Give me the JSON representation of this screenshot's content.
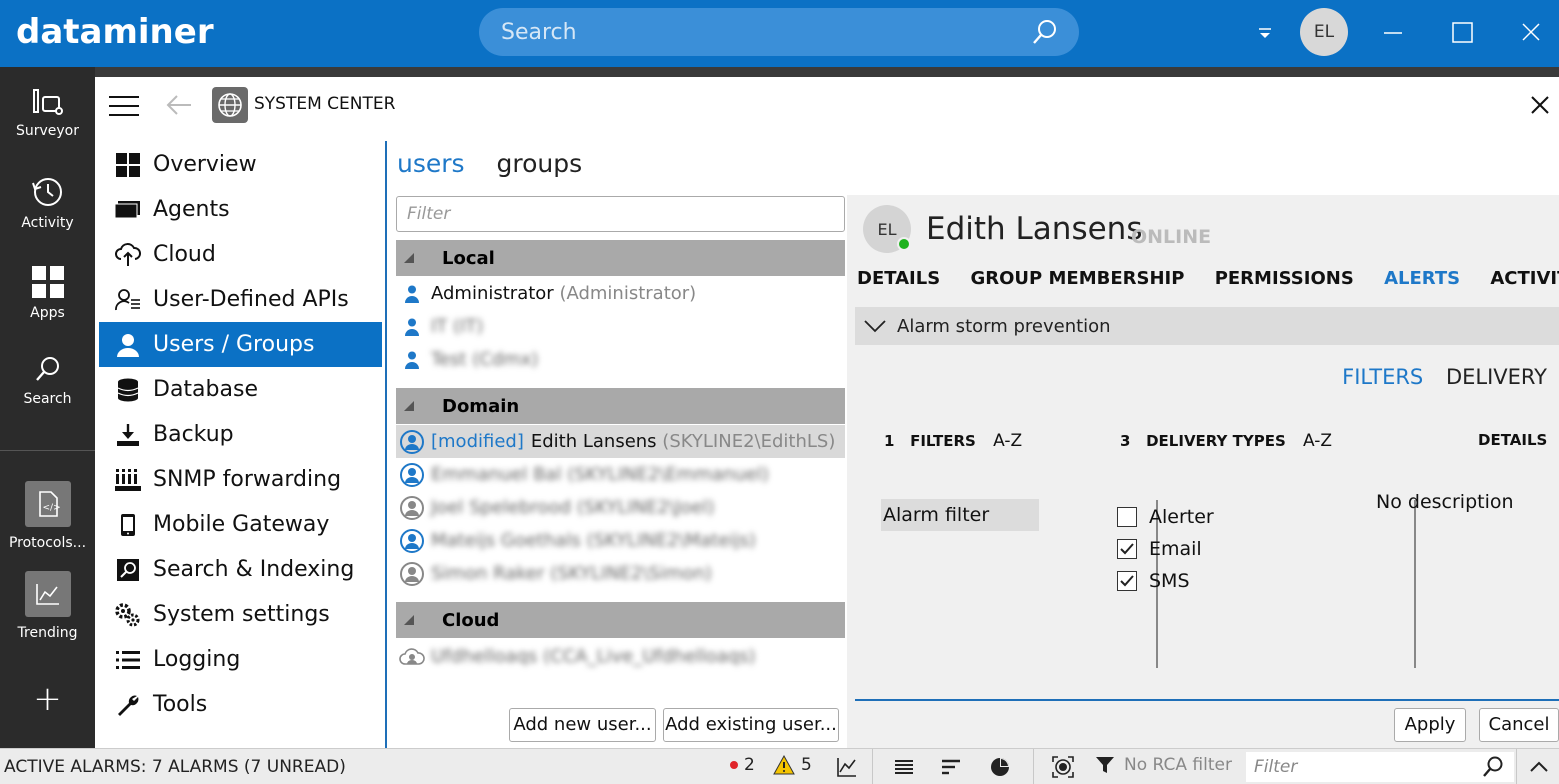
{
  "app": {
    "logo": "dataminer",
    "search_placeholder": "Search",
    "user_initials": "EL"
  },
  "sidebar": {
    "items": [
      {
        "label": "Surveyor",
        "icon": "surveyor-icon"
      },
      {
        "label": "Activity",
        "icon": "history-icon"
      },
      {
        "label": "Apps",
        "icon": "apps-grid-icon"
      },
      {
        "label": "Search",
        "icon": "search-icon"
      },
      {
        "label": "Protocols...",
        "icon": "protocol-file-icon"
      },
      {
        "label": "Trending",
        "icon": "trend-chart-icon"
      }
    ],
    "add_label": "+"
  },
  "system_center": {
    "title": "SYSTEM CENTER",
    "nav": [
      {
        "label": "Overview",
        "icon": "overview-grid-icon"
      },
      {
        "label": "Agents",
        "icon": "agents-icon"
      },
      {
        "label": "Cloud",
        "icon": "cloud-upload-icon"
      },
      {
        "label": "User-Defined APIs",
        "icon": "api-user-icon"
      },
      {
        "label": "Users / Groups",
        "icon": "user-icon"
      },
      {
        "label": "Database",
        "icon": "database-icon"
      },
      {
        "label": "Backup",
        "icon": "download-icon"
      },
      {
        "label": "SNMP forwarding",
        "icon": "snmp-icon"
      },
      {
        "label": "Mobile Gateway",
        "icon": "mobile-icon"
      },
      {
        "label": "Search & Indexing",
        "icon": "search-index-icon"
      },
      {
        "label": "System settings",
        "icon": "gears-icon"
      },
      {
        "label": "Logging",
        "icon": "list-icon"
      },
      {
        "label": "Tools",
        "icon": "wrench-icon"
      }
    ],
    "active_nav": "Users / Groups"
  },
  "users_groups": {
    "tabs": [
      {
        "label": "users",
        "active": true
      },
      {
        "label": "groups",
        "active": false
      }
    ],
    "filter_placeholder": "Filter",
    "groups": [
      {
        "name": "Local",
        "users": [
          {
            "name": "Administrator",
            "detail": "(Administrator)"
          },
          {
            "name": "IT",
            "detail": "(IT)",
            "blurred": true
          },
          {
            "name": "Test",
            "detail": "(Cdmx)",
            "blurred": true
          }
        ]
      },
      {
        "name": "Domain",
        "users": [
          {
            "modified": "[modified]",
            "name": "Edith Lansens",
            "detail": "(SKYLINE2\\EdithLS)",
            "selected": true
          },
          {
            "name": "Emmanuel Bal",
            "detail": "(SKYLINE2\\Emmanuel)",
            "blurred": true
          },
          {
            "name": "Joel Spelebrood",
            "detail": "(SKYLINE2\\Joel)",
            "blurred": true
          },
          {
            "name": "Mateijs Goethals",
            "detail": "(SKYLINE2\\Mateijs)",
            "blurred": true
          },
          {
            "name": "Simon Raker",
            "detail": "(SKYLINE2\\Simon)",
            "blurred": true
          }
        ]
      },
      {
        "name": "Cloud",
        "users": [
          {
            "name": "Ufdhelloaqs",
            "detail": "(CCA_Live_Ufdhelloaqs)",
            "blurred": true
          }
        ]
      }
    ],
    "add_new_user": "Add new user...",
    "add_existing_user": "Add existing user..."
  },
  "detail": {
    "initials": "EL",
    "name": "Edith Lansens",
    "status": "ONLINE",
    "tabs": [
      {
        "label": "DETAILS",
        "active": false
      },
      {
        "label": "GROUP MEMBERSHIP",
        "active": false
      },
      {
        "label": "PERMISSIONS",
        "active": false
      },
      {
        "label": "ALERTS",
        "active": true
      },
      {
        "label": "ACTIVITY",
        "active": false
      }
    ],
    "storm_label": "Alarm storm prevention",
    "sub_tabs": [
      {
        "label": "FILTERS",
        "active": true
      },
      {
        "label": "DELIVERY",
        "active": false
      }
    ],
    "filters_count": "1",
    "filters_label": "FILTERS",
    "delivery_count": "3",
    "delivery_label": "DELIVERY TYPES",
    "az": "A-Z",
    "details_label": "DETAILS",
    "filter_item": "Alarm filter",
    "delivery_types": [
      {
        "label": "Alerter",
        "checked": false
      },
      {
        "label": "Email",
        "checked": true
      },
      {
        "label": "SMS",
        "checked": true
      }
    ],
    "description": "No description",
    "apply": "Apply",
    "cancel": "Cancel"
  },
  "statusbar": {
    "alarms_text": "ACTIVE ALARMS: 7 ALARMS (7 UNREAD)",
    "critical_count": "2",
    "warning_count": "5",
    "rca_filter": "No RCA filter",
    "filter_placeholder": "Filter"
  },
  "colors": {
    "brand_blue": "#0b71c5",
    "accent_blue": "#1e78c8",
    "online_green": "#1db21d",
    "critical_red": "#e0242a",
    "warning_yellow": "#f5c400"
  }
}
